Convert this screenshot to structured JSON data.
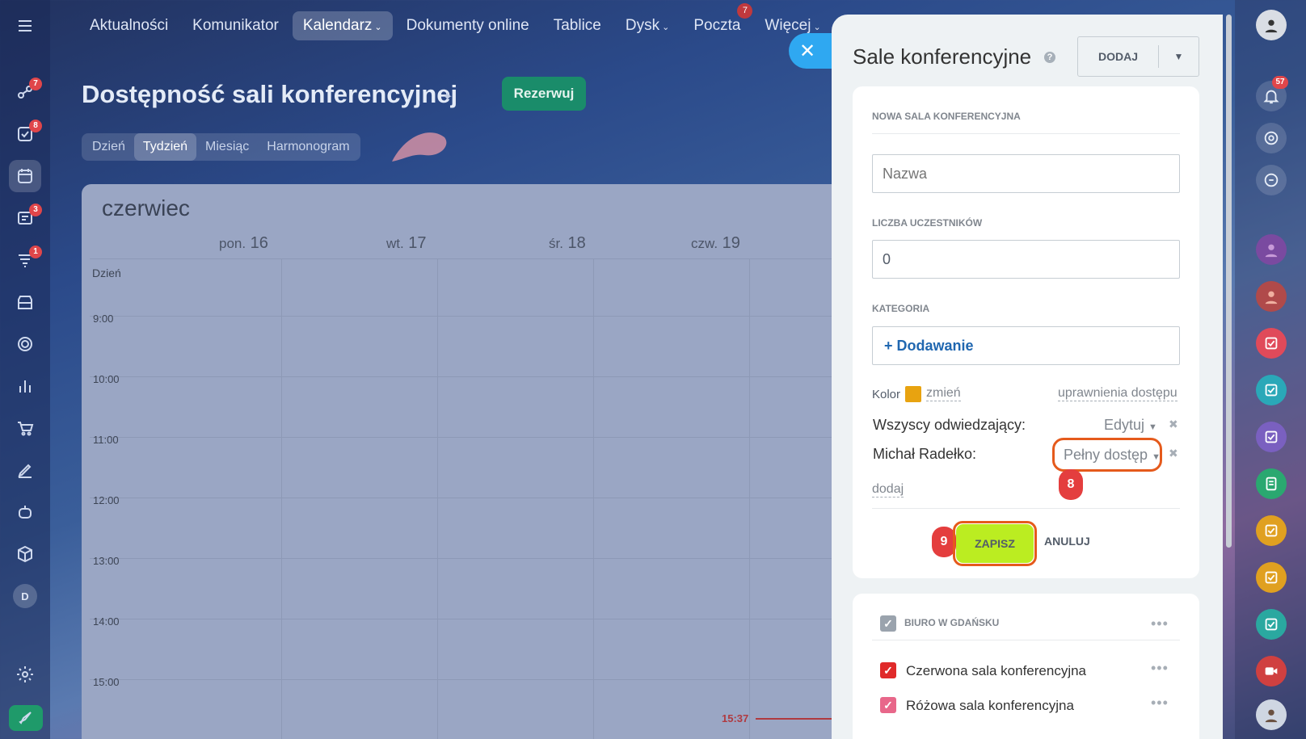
{
  "nav": {
    "items": [
      {
        "label": "Aktualności"
      },
      {
        "label": "Komunikator"
      },
      {
        "label": "Kalendarz"
      },
      {
        "label": "Dokumenty online"
      },
      {
        "label": "Tablice"
      },
      {
        "label": "Dysk"
      },
      {
        "label": "Poczta",
        "badge": "7"
      },
      {
        "label": "Więcej"
      }
    ]
  },
  "left_sidebar": {
    "badges": {
      "sites": "7",
      "tasks": "8",
      "messages": "3",
      "crm": "1"
    },
    "avatar_letter": "D"
  },
  "page": {
    "title": "Dostępność sali konferencyjnej",
    "reserve_button": "Rezerwuj",
    "view_tabs": [
      "Dzień",
      "Tydzień",
      "Miesiąc",
      "Harmonogram"
    ],
    "active_tab": "Tydzień"
  },
  "calendar": {
    "month": "czerwiec",
    "days": [
      {
        "name": "pon.",
        "num": "16"
      },
      {
        "name": "wt.",
        "num": "17"
      },
      {
        "name": "śr.",
        "num": "18"
      },
      {
        "name": "czw.",
        "num": "19"
      }
    ],
    "allday_label": "Dzień",
    "hours": [
      "9:00",
      "10:00",
      "11:00",
      "12:00",
      "13:00",
      "14:00",
      "15:00"
    ],
    "now_time": "15:37"
  },
  "right_sidebar": {
    "notifications_badge": "57"
  },
  "panel": {
    "title": "Sale konferencyjne",
    "add_button": "DODAJ",
    "form": {
      "section_title": "NOWA SALA KONFERENCYJNA",
      "name_placeholder": "Nazwa",
      "participants_label": "LICZBA UCZESTNIKÓW",
      "participants_value": "0",
      "category_label": "KATEGORIA",
      "category_add": "+ Dodawanie",
      "color_label": "Kolor",
      "color_value": "#e8a310",
      "color_change": "zmień",
      "access_link": "uprawnienia dostępu",
      "permissions": [
        {
          "who": "Wszyscy odwiedzający:",
          "level": "Edytuj"
        },
        {
          "who": "Michał Radełko:",
          "level": "Pełny dostęp"
        }
      ],
      "add_permission": "dodaj",
      "save": "ZAPISZ",
      "cancel": "ANULUJ"
    },
    "steps": {
      "permission": "8",
      "save": "9"
    },
    "list": {
      "group": "BIURO W GDAŃSKU",
      "rooms": [
        {
          "name": "Czerwona sala konferencyjna",
          "color": "#e02a2a"
        },
        {
          "name": "Różowa sala konferencyjna",
          "color": "#e8678a"
        }
      ]
    }
  }
}
